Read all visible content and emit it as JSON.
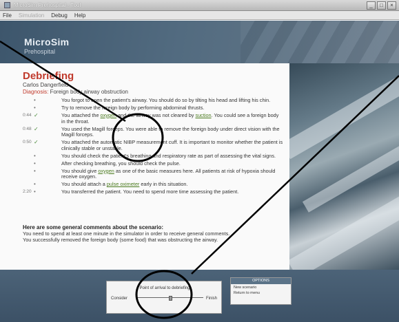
{
  "window": {
    "title": "MicroSim Prehospital - Tool",
    "controls": [
      "_",
      "□",
      "×"
    ]
  },
  "menubar": {
    "items": [
      "File",
      "Simulation",
      "Debug",
      "Help"
    ]
  },
  "header": {
    "logo_main": "MicroSim",
    "logo_sub": "Prehospital"
  },
  "debriefing": {
    "heading": "Debriefing",
    "patient": "Carlos Dangerfield",
    "diagnosis_label": "Diagnosis:",
    "diagnosis_value": "Foreign body airway obstruction",
    "items": [
      {
        "time": "",
        "mark": "bullet",
        "text": "You forgot to open the patient's airway. You should do so by tilting his head and lifting his chin."
      },
      {
        "time": "",
        "mark": "bullet",
        "text": "Try to remove the foreign body by performing abdominal thrusts."
      },
      {
        "time": "0:44",
        "mark": "check",
        "text_pre": "You attached the ",
        "link1": "oxygen",
        "text_mid": " and the airway was not cleared by ",
        "link2": "suction",
        "text_post": ". You could see a foreign body in the throat."
      },
      {
        "time": "0:48",
        "mark": "check",
        "text": "You used the Magill forceps. You were able to remove the foreign body under direct vision with the Magill forceps."
      },
      {
        "time": "0:50",
        "mark": "check",
        "text": "You attached the automatic NIBP measurement cuff. It is important to monitor whether the patient is clinically stable or unstable."
      },
      {
        "time": "",
        "mark": "bullet",
        "text": "You should check the patient's breathing and respiratory rate as part of assessing the vital signs."
      },
      {
        "time": "",
        "mark": "bullet",
        "text": "After checking breathing, you should check the pulse."
      },
      {
        "time": "",
        "mark": "bullet",
        "text_pre": "You should give ",
        "link1": "oxygen",
        "text_post": " as one of the basic measures here. All patients at risk of hypoxia should receive oxygen."
      },
      {
        "time": "",
        "mark": "bullet",
        "text_pre": "You should attach a ",
        "link1": "pulse oximeter",
        "text_post": " early in this situation."
      },
      {
        "time": "2:20",
        "mark": "bullet",
        "text": "You transferred the patient. You need to spend more time assessing the patient."
      }
    ],
    "comments_title": "Here are some general comments about the scenario:",
    "comments": [
      "You need to spend at least one minute in the simulator in order to receive general comments.",
      "You successfully removed the foreign body (some food) that was obstructing the airway."
    ]
  },
  "scrubber": {
    "label": "Point of arrival to debriefing",
    "left_label": "Consider",
    "right_label": "Finish",
    "position": 0.5
  },
  "options": {
    "title": "OPTIONS",
    "items": [
      "New scenario",
      "Return to menu"
    ]
  },
  "callouts": {
    "color": "#000000",
    "count": 2
  }
}
